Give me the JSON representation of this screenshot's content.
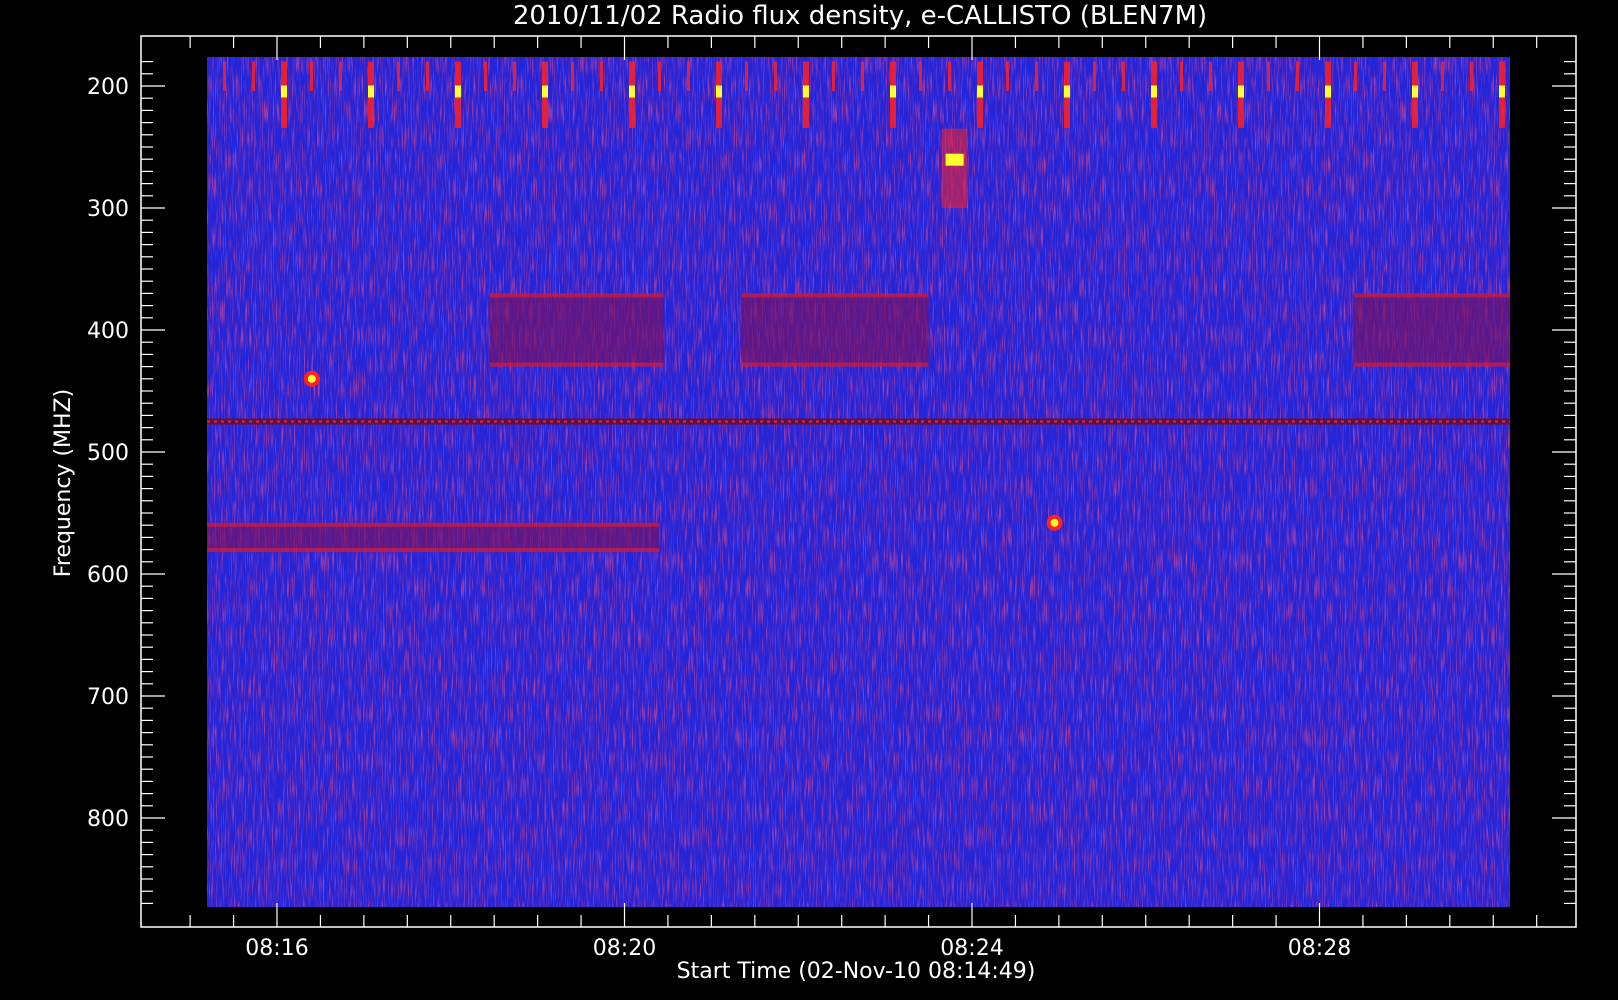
{
  "chart_data": {
    "type": "heatmap",
    "title": "2010/11/02  Radio flux density, e-CALLISTO (BLEN7M)",
    "xlabel": "Start Time (02-Nov-10 08:14:49)",
    "ylabel": "Frequency (MHZ)",
    "x_ticks": [
      "08:16",
      "08:20",
      "08:24",
      "08:28"
    ],
    "x_tick_minutes": [
      16,
      20,
      24,
      28
    ],
    "xlim_minutes": [
      14.8,
      30.75
    ],
    "y_ticks": [
      200,
      300,
      400,
      500,
      600,
      700,
      800
    ],
    "ylim": [
      175,
      875
    ],
    "y_inverted": true,
    "grid": false,
    "colors": {
      "background": "#000000",
      "axes": "#ffffff",
      "low": "#2424d8",
      "mid": "#7a1262",
      "high": "#ff2020",
      "peak": "#ffff30"
    },
    "features": [
      {
        "label": "periodic interference bursts",
        "freq_range": [
          175,
          230
        ],
        "time_range": [
          15.0,
          30.75
        ]
      },
      {
        "label": "burst cluster",
        "freq_range": [
          235,
          300
        ],
        "time_range": [
          23.65,
          23.95
        ]
      },
      {
        "label": "band 370-430 MHz",
        "freq_range": [
          370,
          430
        ],
        "time_range": [
          18.45,
          20.45
        ]
      },
      {
        "label": "band 370-430 MHz",
        "freq_range": [
          370,
          430
        ],
        "time_range": [
          21.35,
          23.5
        ]
      },
      {
        "label": "band 370-430 MHz",
        "freq_range": [
          370,
          430
        ],
        "time_range": [
          28.4,
          30.75
        ]
      },
      {
        "label": "interference line",
        "freq": 475
      },
      {
        "label": "band 560-580 MHz",
        "freq_range": [
          558,
          582
        ],
        "time_range": [
          15.0,
          20.4
        ]
      },
      {
        "label": "point source",
        "freq": 558,
        "time": 24.95
      },
      {
        "label": "point source",
        "freq": 440,
        "time": 16.4
      }
    ]
  }
}
